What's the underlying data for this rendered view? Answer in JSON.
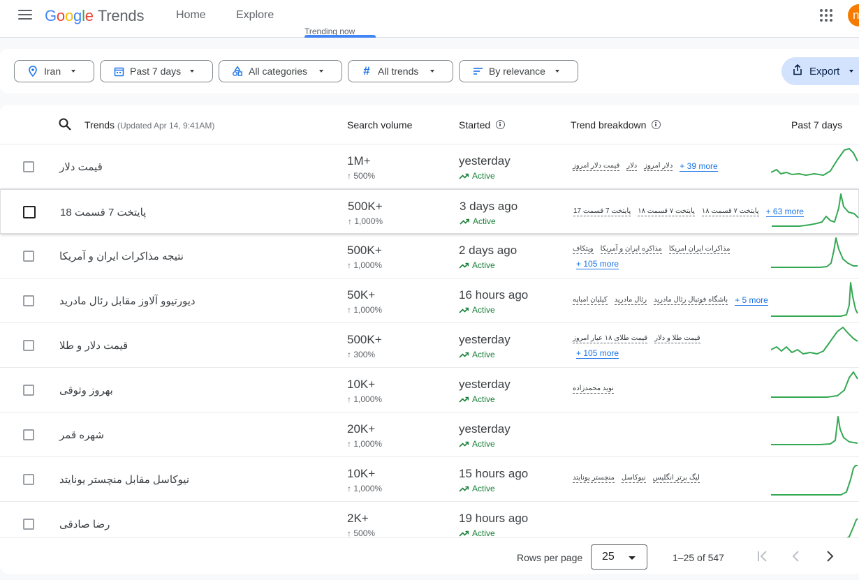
{
  "header": {
    "logo": {
      "g1": "G",
      "g2": "o",
      "g3": "o",
      "g4": "g",
      "g5": "l",
      "g6": "e",
      "product": "Trends"
    },
    "tabs": [
      {
        "label": "Home"
      },
      {
        "label": "Explore"
      },
      {
        "label": "Trending now"
      }
    ],
    "active_tab": "Trending now",
    "avatar_letter": "n",
    "colors": {
      "accent": "#4285f4",
      "avatar": "#f57c00"
    }
  },
  "filters": {
    "location": "Iran",
    "time": "Past 7 days",
    "category": "All categories",
    "trend_type": "All trends",
    "sort": "By relevance",
    "export": "Export"
  },
  "table": {
    "headers": {
      "trends": "Trends",
      "updated": "(Updated Apr 14, 9:41AM)",
      "volume": "Search volume",
      "started": "Started",
      "breakdown": "Trend breakdown",
      "past": "Past 7 days"
    },
    "rows": [
      {
        "title": "قیمت دلار",
        "volume": "1M+",
        "pct": "500%",
        "started": "yesterday",
        "status": "Active",
        "lines": [
          [
            "قیمت دلار امروز",
            "دلار",
            "دلار امروز"
          ]
        ],
        "more": "+ 39 more",
        "more_inline": true
      },
      {
        "title": "پایتخت 7 قسمت 18",
        "volume": "500K+",
        "pct": "1,000%",
        "started": "3 days ago",
        "status": "Active",
        "lines": [
          [
            "پایتخت 7 قسمت 17",
            "پایتخت ۷ قسمت ۱۸",
            "پایتخت ۷ قسمت ۱۸"
          ]
        ],
        "more": "+ 63 more",
        "more_inline": true
      },
      {
        "title": "نتیجه مذاکرات ایران و آمریکا",
        "volume": "500K+",
        "pct": "1,000%",
        "started": "2 days ago",
        "status": "Active",
        "lines": [
          [
            "ویتکاف",
            "مذاکره ایران و آمریکا",
            "مذاکرات ایران امریکا"
          ]
        ],
        "more": "+ 105 more",
        "more_inline": false
      },
      {
        "title": "دیورتیوو آلاوز مقابل رئال مادرید",
        "volume": "50K+",
        "pct": "1,000%",
        "started": "16 hours ago",
        "status": "Active",
        "lines": [
          [
            "کیلیان امباپه",
            "رئال مادرید",
            "باشگاه فوتبال رئال مادرید"
          ]
        ],
        "more": "+ 5 more",
        "more_inline": true
      },
      {
        "title": "قیمت دلار و طلا",
        "volume": "500K+",
        "pct": "300%",
        "started": "yesterday",
        "status": "Active",
        "lines": [
          [
            "قیمت طلای ۱۸ عیار امروز",
            "قیمت طلا و دلار"
          ]
        ],
        "more": "+ 105 more",
        "more_inline": false
      },
      {
        "title": "بهروز وثوقی",
        "volume": "10K+",
        "pct": "1,000%",
        "started": "yesterday",
        "status": "Active",
        "lines": [
          [
            "نوید محمدزاده"
          ]
        ],
        "more": "",
        "more_inline": true
      },
      {
        "title": "شهره قمر",
        "volume": "20K+",
        "pct": "1,000%",
        "started": "yesterday",
        "status": "Active",
        "lines": [],
        "more": "",
        "more_inline": true
      },
      {
        "title": "نیوکاسل مقابل منچستر یونایتد",
        "volume": "10K+",
        "pct": "1,000%",
        "started": "15 hours ago",
        "status": "Active",
        "lines": [
          [
            "منچستر یونایتد",
            "نیوکاسل",
            "لیگ برتر انگلیس"
          ]
        ],
        "more": "",
        "more_inline": true
      },
      {
        "title": "رضا صادقی",
        "volume": "2K+",
        "pct": "500%",
        "started": "19 hours ago",
        "status": "Active",
        "lines": [],
        "more": "",
        "more_inline": true
      }
    ]
  },
  "pager": {
    "rows_label": "Rows per page",
    "rows_value": "25",
    "range": "1–25 of 547"
  },
  "sparkline_color": "#34a853"
}
